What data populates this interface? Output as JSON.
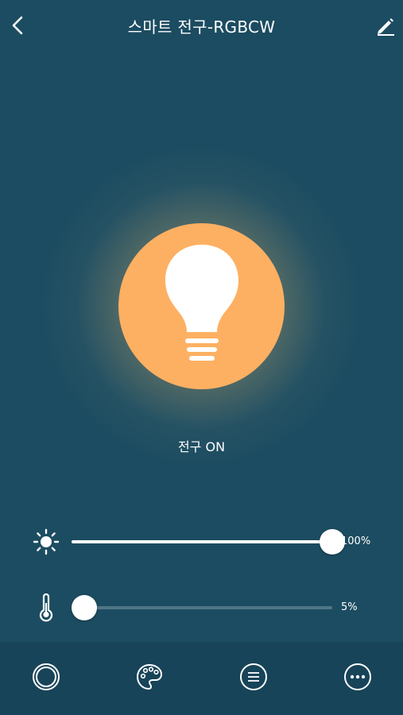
{
  "header": {
    "title": "스마트 전구-RGBCW",
    "back_icon": "chevron-left-icon",
    "edit_icon": "pencil-icon"
  },
  "bulb": {
    "icon": "lightbulb-icon",
    "color": "#fdb062",
    "status": "전구 ON"
  },
  "brightness": {
    "icon": "sun-icon",
    "level": 1.0,
    "value_text": "100%"
  },
  "temperature": {
    "icon": "thermometer-icon",
    "level": 0.05,
    "value_text": "5%"
  },
  "tabs": [
    {
      "name": "power",
      "icon": "circle-ring-icon"
    },
    {
      "name": "color",
      "icon": "palette-icon"
    },
    {
      "name": "scene",
      "icon": "list-circle-icon"
    },
    {
      "name": "more",
      "icon": "more-dots-icon"
    }
  ],
  "colors": {
    "background": "#1c4c61",
    "bottom_bar": "#174458",
    "bulb_on": "#fdb062",
    "track_inactive": "#4f7585",
    "accent": "#ffffff"
  }
}
